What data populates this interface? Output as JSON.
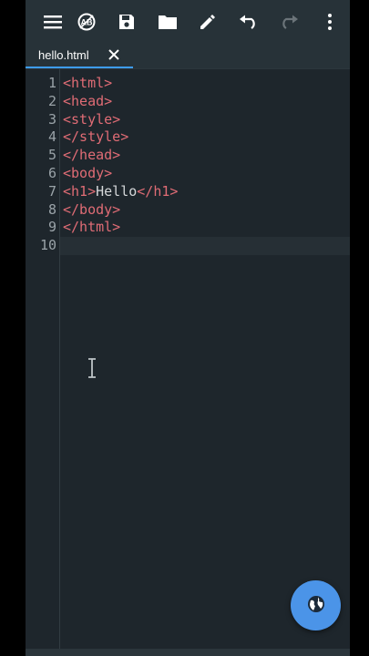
{
  "toolbar": {
    "icons": [
      "menu-icon",
      "autocomplete-icon",
      "save-icon",
      "folder-icon",
      "edit-icon",
      "undo-icon",
      "redo-icon",
      "more-vert-icon"
    ]
  },
  "tabs": [
    {
      "label": "hello.html",
      "active": true
    }
  ],
  "editor": {
    "line_numbers": [
      "1",
      "2",
      "3",
      "4",
      "5",
      "6",
      "7",
      "8",
      "9",
      "10"
    ],
    "lines": [
      {
        "open": "<html>"
      },
      {
        "open": "<head>"
      },
      {
        "open": "<style>"
      },
      {
        "open": "</style>"
      },
      {
        "open": "</head>"
      },
      {
        "open": "<body>"
      },
      {
        "open": "<h1>",
        "text": "Hello",
        "close": "</h1>"
      },
      {
        "open": "</body>"
      },
      {
        "open": "</html>"
      },
      {
        "open": ""
      }
    ],
    "current_line": 10
  },
  "fab": {
    "icon": "globe-icon"
  },
  "colors": {
    "background": "#1e262c",
    "toolbar": "#273238",
    "tag": "#e06c75",
    "text": "#d4d7d9",
    "accent": "#3d9cf0",
    "fab": "#4b94e8"
  }
}
